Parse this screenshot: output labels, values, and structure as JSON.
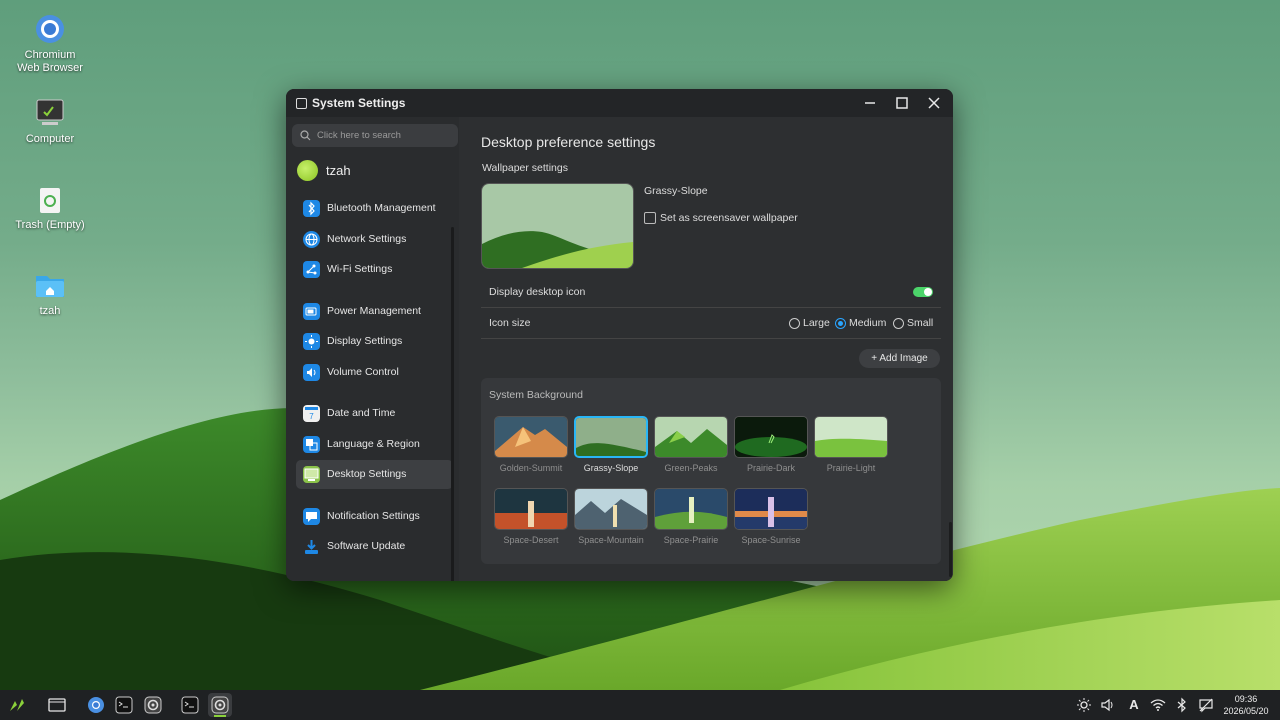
{
  "desktop": {
    "icons": [
      {
        "label": "Chromium\nWeb Browser",
        "icon": "chromium-icon"
      },
      {
        "label": "Computer",
        "icon": "computer-icon"
      },
      {
        "label": "Trash (Empty)",
        "icon": "trash-icon"
      },
      {
        "label": "tzah",
        "icon": "home-folder-icon"
      }
    ]
  },
  "window": {
    "title": "System Settings",
    "controls": [
      "minimize",
      "maximize",
      "close"
    ]
  },
  "sidebar": {
    "search_placeholder": "Click here to search",
    "user": "tzah",
    "items": [
      {
        "label": "Bluetooth Management",
        "icon": "bluetooth-icon"
      },
      {
        "label": "Network Settings",
        "icon": "globe-icon"
      },
      {
        "label": "Wi-Fi Settings",
        "icon": "wifi-network-icon"
      },
      {
        "label": "Power Management",
        "icon": "battery-icon"
      },
      {
        "label": "Display Settings",
        "icon": "brightness-icon"
      },
      {
        "label": "Volume Control",
        "icon": "volume-icon"
      },
      {
        "label": "Date and Time",
        "icon": "calendar-icon"
      },
      {
        "label": "Language & Region",
        "icon": "language-icon"
      },
      {
        "label": "Desktop Settings",
        "icon": "desktop-icon",
        "active": true
      },
      {
        "label": "Notification Settings",
        "icon": "notification-icon"
      },
      {
        "label": "Software Update",
        "icon": "download-icon"
      }
    ]
  },
  "main": {
    "title": "Desktop preference settings",
    "wallpaper_section": "Wallpaper settings",
    "current_wallpaper": "Grassy-Slope",
    "screensaver_checkbox": "Set as screensaver wallpaper",
    "screensaver_checked": false,
    "display_desktop_icon_label": "Display desktop icon",
    "display_desktop_icon_on": true,
    "icon_size_label": "Icon size",
    "icon_size_options": [
      "Large",
      "Medium",
      "Small"
    ],
    "icon_size_selected": "Medium",
    "add_image_label": "+ Add Image",
    "system_background_label": "System Background",
    "wallpapers": [
      {
        "name": "Golden-Summit"
      },
      {
        "name": "Grassy-Slope",
        "selected": true
      },
      {
        "name": "Green-Peaks"
      },
      {
        "name": "Prairie-Dark"
      },
      {
        "name": "Prairie-Light"
      },
      {
        "name": "Space-Desert"
      },
      {
        "name": "Space-Mountain"
      },
      {
        "name": "Space-Prairie"
      },
      {
        "name": "Space-Sunrise"
      }
    ]
  },
  "taskbar": {
    "apps": [
      "start-menu-icon",
      "show-desktop-icon",
      "chromium-icon",
      "terminal-icon",
      "settings-icon",
      "terminal-running-icon",
      "settings-running-icon"
    ],
    "tray": [
      "brightness-icon",
      "volume-icon",
      "input-method-icon",
      "wifi-icon",
      "bluetooth-icon",
      "notifications-off-icon"
    ],
    "input_method": "A",
    "time": "09:36",
    "date": "2026/05/20"
  },
  "colors": {
    "accent": "#29b6f6",
    "toggle_on": "#4cd46a",
    "window_bg": "#2d2f31",
    "sidebar_bg": "#2a2c2e",
    "taskbar_bg": "#1f2123"
  }
}
